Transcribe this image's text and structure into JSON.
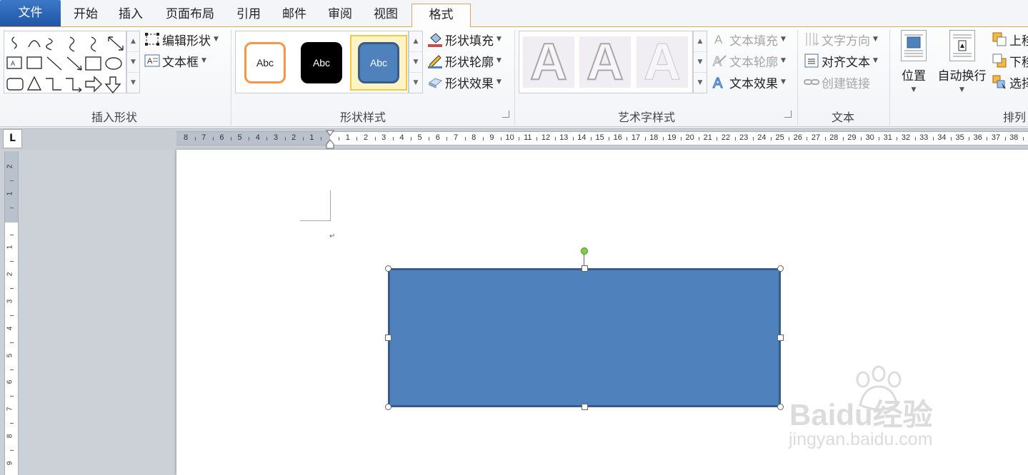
{
  "tabs": {
    "file": "文件",
    "home": "开始",
    "insert": "插入",
    "page_layout": "页面布局",
    "references": "引用",
    "mailings": "邮件",
    "review": "审阅",
    "view": "视图",
    "format": "格式"
  },
  "insert_shapes": {
    "label": "插入形状",
    "edit_shape": "编辑形状",
    "text_box": "文本框"
  },
  "shape_styles": {
    "label": "形状样式",
    "swatch_text": "Abc",
    "swatch_colors": [
      "#ffffff",
      "#000000",
      "#4f81bd"
    ],
    "swatch_borders": [
      "#f79646",
      "#000000",
      "#385d8a"
    ],
    "shape_fill": "形状填充",
    "shape_outline": "形状轮廓",
    "shape_effects": "形状效果"
  },
  "wordart_styles": {
    "label": "艺术字样式",
    "swatch_letter": "A",
    "text_fill": "文本填充",
    "text_outline": "文本轮廓",
    "text_effects": "文本效果"
  },
  "text_group": {
    "label": "文本",
    "text_direction": "文字方向",
    "align_text": "对齐文本",
    "create_link": "创建链接"
  },
  "arrange_group": {
    "label": "排列",
    "position": "位置",
    "wrap_text": "自动换行",
    "bring_forward": "上移",
    "send_backward": "下移",
    "selection_pane": "选择"
  },
  "ruler": {
    "corner": "L",
    "h_ticks": [
      "8",
      "7",
      "6",
      "5",
      "4",
      "3",
      "2",
      "1",
      "",
      "1",
      "2",
      "3",
      "4",
      "5",
      "6",
      "7",
      "8",
      "9",
      "10",
      "11",
      "12",
      "13",
      "14",
      "15",
      "16",
      "17",
      "18",
      "19",
      "20",
      "21",
      "22",
      "23",
      "24",
      "25",
      "26",
      "27",
      "28",
      "29",
      "30",
      "31",
      "32",
      "33",
      "34",
      "35",
      "36",
      "37",
      "38"
    ],
    "v_ticks": [
      "2",
      "1",
      "",
      "1",
      "2",
      "3",
      "4",
      "5",
      "6",
      "7",
      "8",
      "9"
    ]
  },
  "document": {
    "paragraph_mark": "↵",
    "shape_fill_color": "#4f81bd",
    "shape_border_color": "#385d8a"
  },
  "watermark": {
    "brand": "Baidu经验",
    "url": "jingyan.baidu.com"
  }
}
